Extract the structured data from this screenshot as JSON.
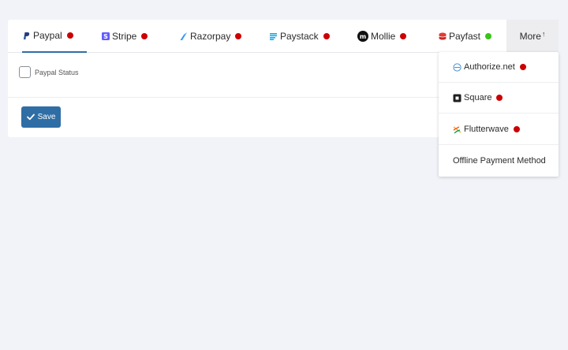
{
  "tabs": [
    {
      "label": "Paypal",
      "icon": "paypal-icon",
      "status": "red",
      "active": true
    },
    {
      "label": "Stripe",
      "icon": "stripe-icon",
      "status": "red"
    },
    {
      "label": "Razorpay",
      "icon": "razorpay-icon",
      "status": "red"
    },
    {
      "label": "Paystack",
      "icon": "paystack-icon",
      "status": "red"
    },
    {
      "label": "Mollie",
      "icon": "mollie-icon",
      "status": "red"
    },
    {
      "label": "Payfast",
      "icon": "payfast-icon",
      "status": "green"
    }
  ],
  "more": {
    "label": "More",
    "arrow": "↑"
  },
  "dropdown": [
    {
      "label": "Authorize.net",
      "icon": "authorize-net-icon",
      "status": "red"
    },
    {
      "label": "Square",
      "icon": "square-icon",
      "status": "red"
    },
    {
      "label": "Flutterwave",
      "icon": "flutterwave-icon",
      "status": "red"
    },
    {
      "label": "Offline Payment Method"
    }
  ],
  "form": {
    "status_label": "Paypal Status",
    "checked": false
  },
  "save": {
    "label": "Save"
  },
  "colors": {
    "primary": "#2f6ea5",
    "status_red": "#cc0000",
    "status_green": "#39c419",
    "background": "#f1f3f8"
  }
}
